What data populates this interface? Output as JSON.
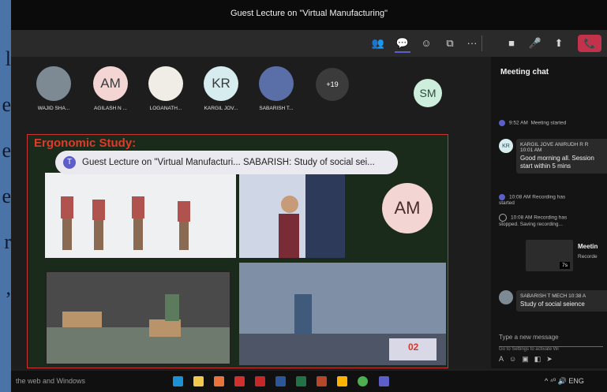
{
  "background_text": {
    "glyphs": [
      "l",
      "e",
      "e",
      "e",
      "r",
      ","
    ]
  },
  "window": {
    "title": "Guest Lecture on \"Virtual Manufacturing\""
  },
  "toolbar": {
    "icons": [
      "people-icon",
      "chat-icon",
      "reactions-icon",
      "share-tray-icon",
      "more-icon",
      "camera-off-icon",
      "mic-off-icon",
      "share-icon",
      "hang-up-icon"
    ],
    "more_glyph": "···"
  },
  "participants": [
    {
      "name": "WAJID SHA...",
      "initials": "",
      "color": "#7d8a93"
    },
    {
      "name": "AGILASH N ...",
      "initials": "AM",
      "color": "#f3d6d3"
    },
    {
      "name": "LOGANATH...",
      "initials": "",
      "color": "#f0ece6"
    },
    {
      "name": "KARGIL JOV...",
      "initials": "KR",
      "color": "#d6ecef"
    },
    {
      "name": "SABARISH T...",
      "initials": "",
      "color": "#5a6fa8"
    }
  ],
  "overflow_count": "+19",
  "extra_participant": {
    "initials": "SM",
    "color": "#cdeedd"
  },
  "share": {
    "slide_title": "Ergonomic Study:",
    "banner": "Guest Lecture on \"Virtual Manufacturi...  SABARISH: Study of social sei...",
    "presenter_initials": "AM",
    "panel_label": "02"
  },
  "chat": {
    "header": "Meeting chat",
    "events": [
      {
        "time": "9:52 AM",
        "text": "Meeting started"
      },
      {
        "time": "10:08 AM",
        "text": "Recording has started"
      },
      {
        "time": "10:08 AM",
        "text": "Recording has stopped. Saving recording..."
      }
    ],
    "messages": [
      {
        "initials": "KR",
        "author": "KARGIL JOVE ANIRUDH R R",
        "time": "10:01 AM",
        "text": "Good morning all. Session start within 5 mins"
      },
      {
        "initials": "",
        "author": "SABARISH T MECH",
        "time": "10:38 A",
        "text": "Study of social seience"
      }
    ],
    "recording_card_label": "Meetin",
    "recording_card_sub": "Recorde",
    "recording_duration": "7s",
    "compose_placeholder": "Type a new message",
    "activation_line": "Go to Settings to activate Wi"
  },
  "taskbar": {
    "search_text": "the web and Windows",
    "tray_text": "^ ⁴⁰ 🔊 ENG"
  },
  "colors": {
    "accent": "#5b5fc7",
    "hangup": "#c4314b",
    "slide_title": "#e03a2a"
  }
}
